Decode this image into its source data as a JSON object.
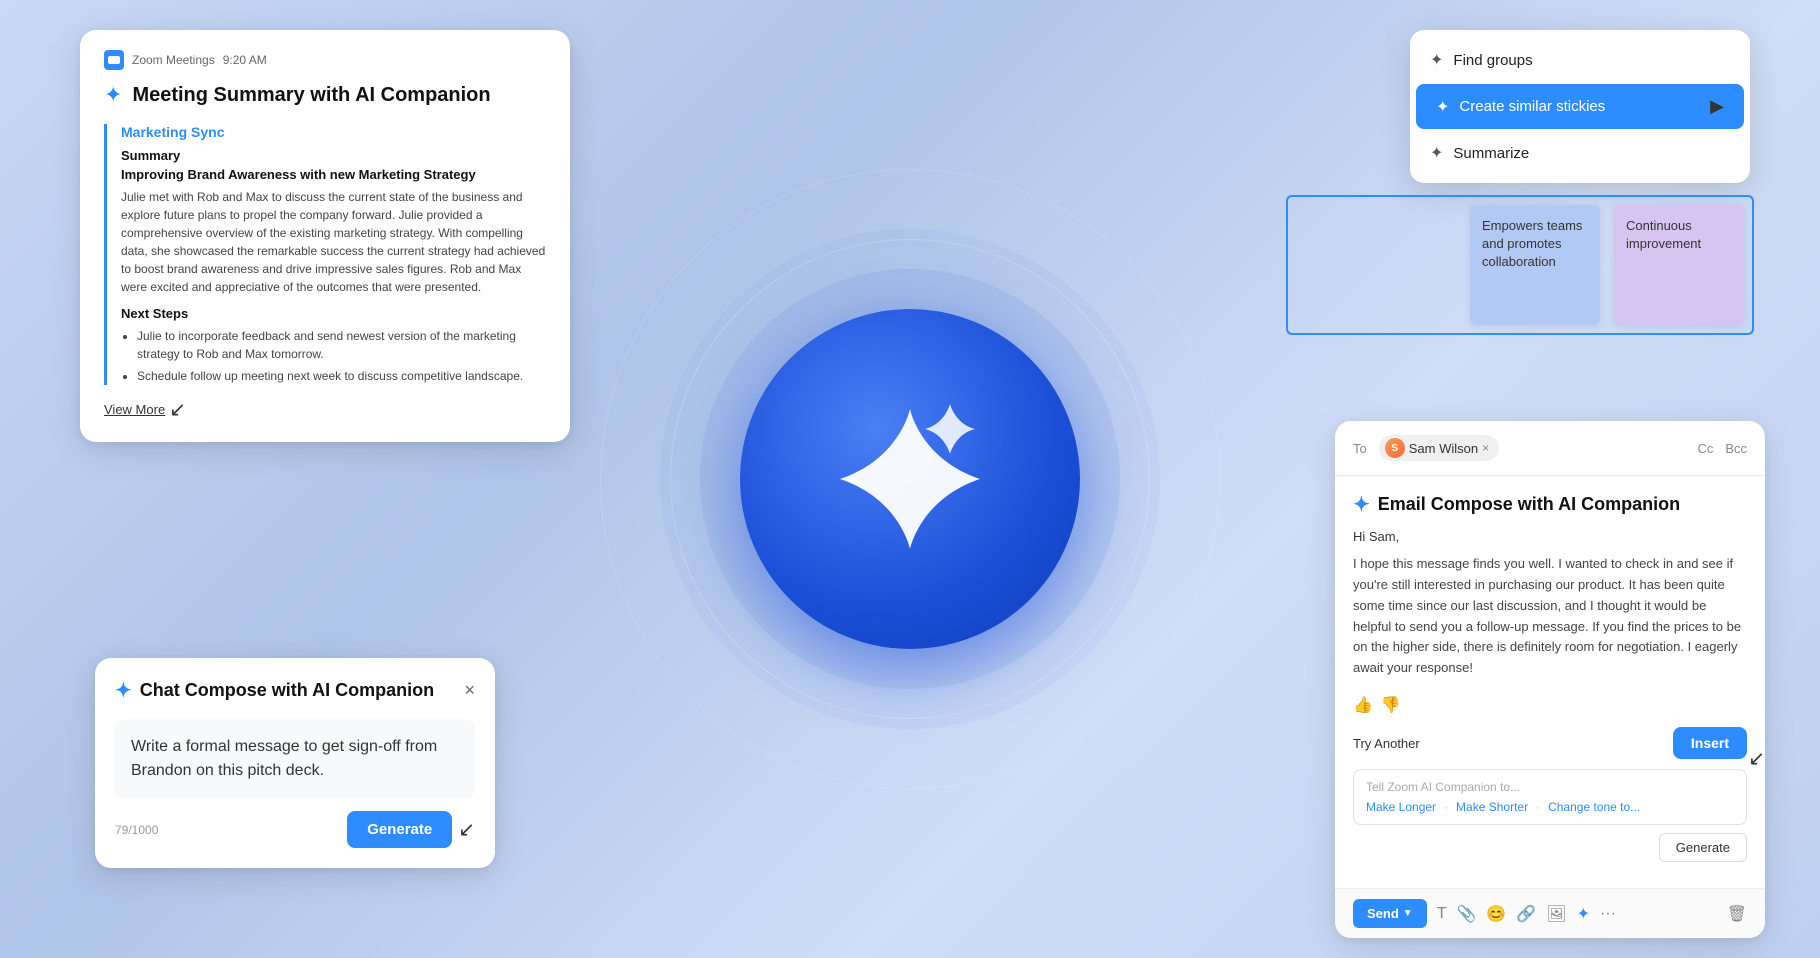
{
  "background": {
    "gradient": "linear-gradient(135deg, #c8d8f0, #b8cce8, #d0dff5)"
  },
  "meeting_card": {
    "title": "Meeting Summary with AI Companion",
    "zoom_app": "Zoom Meetings",
    "time": "9:20 AM",
    "section": "Marketing Sync",
    "summary_label": "Summary",
    "subtitle": "Improving Brand Awareness with new Marketing Strategy",
    "body_text": "Julie met with Rob and Max to discuss the current state of the business and explore future plans to propel the company forward. Julie provided a comprehensive overview of the existing marketing strategy. With compelling data, she showcased the remarkable success the current strategy had achieved to boost brand awareness and drive impressive sales figures. Rob and Max were excited and appreciative of the outcomes that were presented.",
    "next_steps_label": "Next Steps",
    "bullets": [
      "Julie to incorporate feedback and send newest version of the marketing strategy to Rob and Max tomorrow.",
      "Schedule follow up meeting next week to discuss competitive landscape."
    ],
    "view_more": "View More"
  },
  "chat_card": {
    "title": "Chat Compose with AI Companion",
    "close": "×",
    "prompt": "Write a formal message to get sign-off from Brandon on this pitch deck.",
    "char_count": "79/1000",
    "generate_label": "Generate"
  },
  "context_menu": {
    "items": [
      {
        "label": "Find groups",
        "icon": "✦",
        "active": false
      },
      {
        "label": "Create similar stickies",
        "icon": "✦",
        "active": true
      },
      {
        "label": "Summarize",
        "icon": "✦",
        "active": false
      }
    ]
  },
  "sticky_notes": [
    {
      "text": "Empowers teams and promotes collaboration",
      "color": "blue"
    },
    {
      "text": "Continuous improvement",
      "color": "purple"
    }
  ],
  "email_card": {
    "to_label": "To",
    "recipient": "Sam Wilson",
    "cc_label": "Cc",
    "bcc_label": "Bcc",
    "title": "Email Compose with AI Companion",
    "greeting": "Hi Sam,",
    "body": "I hope this message finds you well. I wanted to check in and see if you're still interested in purchasing our product. It has been quite some time since our last discussion, and I thought it would be helpful to send you a follow-up message. If you find the prices to be on the higher side, there is definitely room for negotiation. I eagerly await your response!",
    "try_another": "Try Another",
    "insert": "Insert",
    "prompt_placeholder": "Tell Zoom AI Companion to...",
    "prompt_links": [
      "Make Longer",
      "Make Shorter",
      "Change tone to..."
    ],
    "generate": "Generate",
    "send": "Send"
  }
}
